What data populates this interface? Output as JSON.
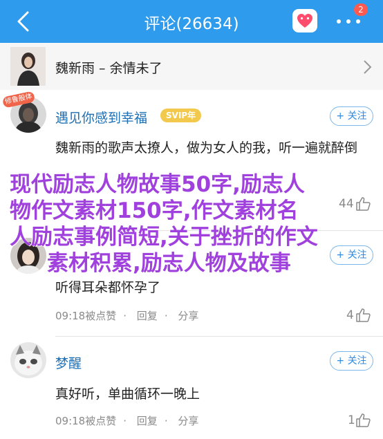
{
  "header": {
    "title": "评论(26634)",
    "notification_count": "2",
    "accent": "#2f9bec"
  },
  "song": {
    "title": "魏新雨 – 余情未了"
  },
  "comments": [
    {
      "username": "遇见你感到幸福",
      "vip_badge": "SVIP年",
      "avatar_badge": "修鲁般体",
      "follow_label": "+ 关注",
      "text": "魏新雨的歌声太撩人，做为女人的我，听一遍就醉倒",
      "likes": "44"
    },
    {
      "username": "",
      "follow_label": "+ 关注",
      "text": "听得耳朵都怀孕了",
      "time": "09:18被点赞",
      "reply_label": "回复",
      "share_label": "分享",
      "likes": "4"
    },
    {
      "username": "梦醒",
      "follow_label": "+ 关注",
      "text": "真好听，单曲循环一晚上",
      "time": "09:18被点赞",
      "reply_label": "回复",
      "share_label": "分享",
      "likes": "1"
    }
  ],
  "overlay": {
    "line1": "现代励志人物故事50字,励志人",
    "line2": "物作文素材150字,作文素材名",
    "line3": "人励志事例简短,关于挫折的作文",
    "line4": "素材积累,励志人物及故事"
  },
  "icons": {
    "back": "back-arrow-icon",
    "heart": "heart-icon",
    "more": "more-dots-icon",
    "chevron": "chevron-right-icon",
    "like": "thumbs-up-icon"
  }
}
